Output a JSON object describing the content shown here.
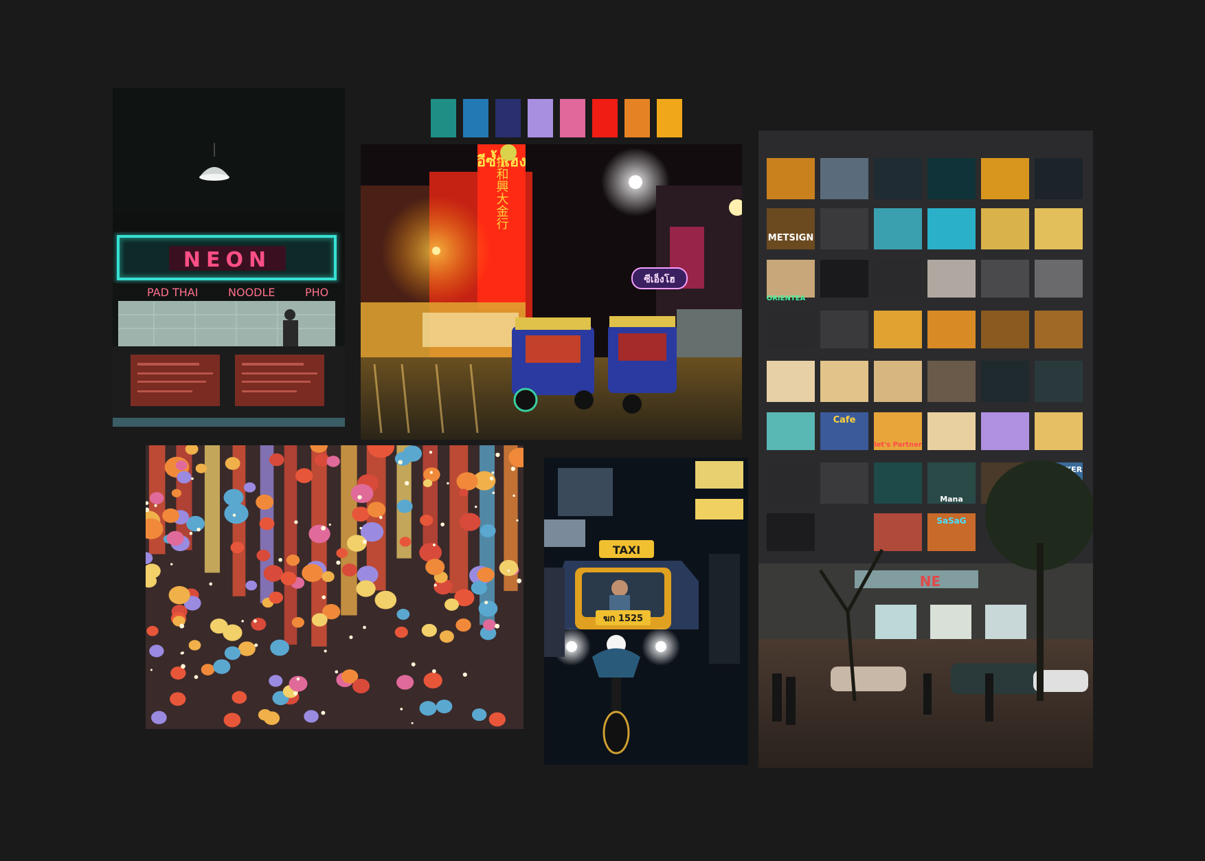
{
  "palette": [
    {
      "name": "teal",
      "color": "#1f8f86"
    },
    {
      "name": "steel-blue",
      "color": "#2379b3"
    },
    {
      "name": "navy",
      "color": "#2a2f6f"
    },
    {
      "name": "lavender",
      "color": "#a98fe0"
    },
    {
      "name": "pink",
      "color": "#e0689a"
    },
    {
      "name": "red",
      "color": "#f01d14"
    },
    {
      "name": "orange",
      "color": "#e58324"
    },
    {
      "name": "amber",
      "color": "#f0a81a"
    }
  ],
  "photos": {
    "neon_shop": {
      "sign": "NEON",
      "menu_items": [
        "PAD THAI",
        "NOODLE",
        "PHO"
      ]
    },
    "street": {
      "thai_sign": "อีซ้ำเฮง",
      "chinese_sign": "振和興大金行",
      "round_sign": "ซีเอ็งโฮ"
    },
    "tuktuk": {
      "taxi_label": "TAXI",
      "plate": "ฆก 1525"
    },
    "building": {
      "signs": [
        "METSIGN",
        "ORIENTEA",
        "Cafe",
        "let's Partner",
        "the MAKER",
        "SaSaG",
        "Mana",
        "NE"
      ]
    }
  }
}
